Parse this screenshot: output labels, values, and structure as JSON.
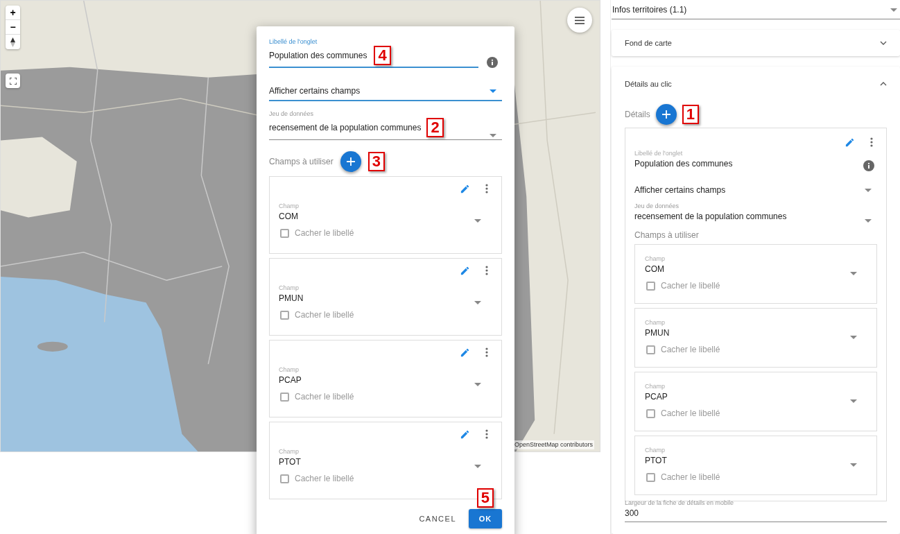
{
  "map": {
    "zoom_in": "+",
    "zoom_out": "−",
    "attribution": "OpenStreetMap contributors"
  },
  "dialog": {
    "title_field": {
      "label": "Libellé de l'onglet",
      "value": "Population des communes",
      "focused": true,
      "callout": "4"
    },
    "mode_select": {
      "value": "Afficher certains champs",
      "focused": true
    },
    "dataset_select": {
      "label": "Jeu de données",
      "value": "recensement de la population communes",
      "callout": "2"
    },
    "fields_heading": "Champs à utiliser",
    "fields_callout": "3",
    "fields": [
      {
        "label": "Champ",
        "value": "COM",
        "checkbox": {
          "label": "Cacher le libellé",
          "checked": false
        }
      },
      {
        "label": "Champ",
        "value": "PMUN",
        "checkbox": {
          "label": "Cacher le libellé",
          "checked": false
        }
      },
      {
        "label": "Champ",
        "value": "PCAP",
        "checkbox": {
          "label": "Cacher le libellé",
          "checked": false
        }
      },
      {
        "label": "Champ",
        "value": "PTOT",
        "checkbox": {
          "label": "Cacher le libellé",
          "checked": false
        }
      }
    ],
    "buttons": [
      {
        "label": "CANCEL",
        "kind": "text"
      },
      {
        "label": "OK",
        "kind": "primary"
      }
    ],
    "buttons_callout": "5"
  },
  "panel": {
    "version_select": {
      "value": "Infos territoires (1.1)"
    },
    "sections": [
      {
        "title": "Fond de carte",
        "expanded": false
      },
      {
        "title": "Détails au clic",
        "expanded": true
      }
    ],
    "details": {
      "heading": "Détails",
      "callout": "1",
      "card": {
        "title_field": {
          "label": "Libellé de l'onglet",
          "value": "Population des communes",
          "focused": false
        },
        "mode_select": {
          "value": "Afficher certains champs",
          "focused": false
        },
        "dataset_select": {
          "label": "Jeu de données",
          "value": "recensement de la population communes"
        },
        "fields_heading": "Champs à utiliser",
        "fields": [
          {
            "label": "Champ",
            "value": "COM",
            "checkbox": {
              "label": "Cacher le libellé",
              "checked": false
            }
          },
          {
            "label": "Champ",
            "value": "PMUN",
            "checkbox": {
              "label": "Cacher le libellé",
              "checked": false
            }
          },
          {
            "label": "Champ",
            "value": "PCAP",
            "checkbox": {
              "label": "Cacher le libellé",
              "checked": false
            }
          },
          {
            "label": "Champ",
            "value": "PTOT",
            "checkbox": {
              "label": "Cacher le libellé",
              "checked": false
            }
          }
        ]
      }
    },
    "mobile_width": {
      "label": "Largeur de la fiche de détails en mobile",
      "value": "300"
    }
  }
}
